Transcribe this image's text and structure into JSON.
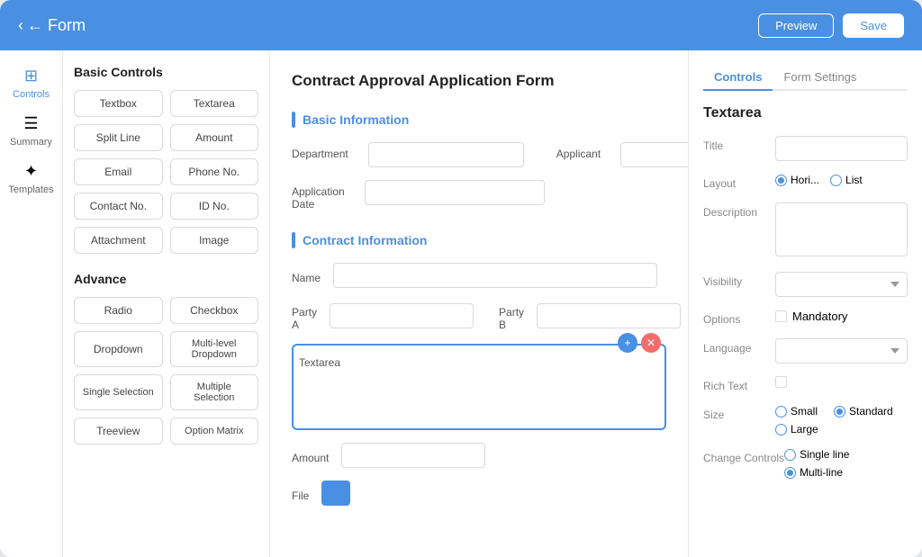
{
  "header": {
    "back_label": "← Form",
    "preview_label": "Preview",
    "save_label": "Save"
  },
  "left_sidebar": {
    "items": [
      {
        "id": "controls",
        "label": "Controls",
        "icon": "⊞",
        "active": true
      },
      {
        "id": "summary",
        "label": "Summary",
        "icon": "☰",
        "active": false
      },
      {
        "id": "templates",
        "label": "Templates",
        "icon": "◈",
        "active": false
      }
    ]
  },
  "controls_panel": {
    "basic_title": "Basic Controls",
    "basic_items": [
      "Textbox",
      "Textarea",
      "Split Line",
      "Amount",
      "Email",
      "Phone No.",
      "Contact No.",
      "ID No.",
      "Attachment",
      "Image"
    ],
    "advance_title": "Advance",
    "advance_items": [
      "Radio",
      "Checkbox",
      "Dropdown",
      "Multi-level Dropdown",
      "Single Selection",
      "Multiple Selection",
      "Treeview",
      "Option Matrix"
    ]
  },
  "form": {
    "title": "Contract Approval Application Form",
    "sections": [
      {
        "id": "basic",
        "title": "Basic Information",
        "fields": [
          {
            "label": "Department",
            "type": "input"
          },
          {
            "label": "Applicant",
            "type": "input"
          },
          {
            "label": "Application Date",
            "type": "input"
          }
        ]
      },
      {
        "id": "contract",
        "title": "Contract Information",
        "fields": [
          {
            "label": "Name",
            "type": "input"
          },
          {
            "label": "Party A",
            "type": "input"
          },
          {
            "label": "Party B",
            "type": "input"
          },
          {
            "label": "Textarea",
            "type": "textarea"
          },
          {
            "label": "Amount",
            "type": "input"
          },
          {
            "label": "File",
            "type": "file"
          }
        ]
      }
    ]
  },
  "right_panel": {
    "tabs": [
      "Controls",
      "Form Settings"
    ],
    "active_tab": "Controls",
    "section_title": "Textarea",
    "properties": {
      "title_label": "Title",
      "layout_label": "Layout",
      "layout_options": [
        "Hori...",
        "List"
      ],
      "layout_selected": "Hori...",
      "description_label": "Description",
      "visibility_label": "Visibility",
      "options_label": "Options",
      "mandatory_label": "Mandatory",
      "language_label": "Language",
      "rich_text_label": "Rich Text",
      "size_label": "Size",
      "size_options": [
        "Small",
        "Standard",
        "Large"
      ],
      "size_selected": "Standard",
      "change_controls_label": "Change Controls",
      "change_options": [
        "Single line",
        "Multi-line"
      ],
      "change_selected": "Multi-line"
    }
  }
}
